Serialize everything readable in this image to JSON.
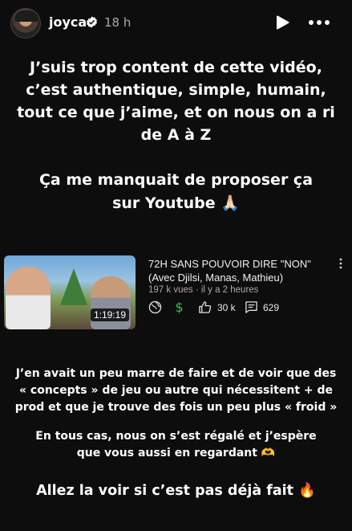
{
  "header": {
    "username": "joyca",
    "time_ago": "18 h",
    "icons": [
      "verified-badge-icon",
      "play-icon",
      "more-options-icon"
    ]
  },
  "story": {
    "paragraph1": "J’suis trop content de cette vidéo, c’est authentique, simple, humain, tout ce que j’aime, et on nous on a ri de A à Z",
    "paragraph2": "Ça me manquait de proposer ça sur Youtube 🙏🏻",
    "paragraph3": "J’en avait un peu marre de faire et de voir que des « concepts » de jeu ou autre qui nécessitent + de prod  et que je trouve des fois un peu plus « froid »",
    "paragraph4": "En tous cas, nous on s’est régalé et j’espère que vous aussi en regardant 🫶",
    "paragraph5": "Allez la voir si c’est pas déjà fait 🔥"
  },
  "video": {
    "title": "72H SANS POUVOIR DIRE \"NON\" (Avec Djilsi, Manas, Mathieu)",
    "meta": "197 k vues · il y a 2 heures",
    "duration": "1:19:19",
    "likes": "30 k",
    "comments": "629",
    "icons": [
      "globe-icon",
      "dollar-icon",
      "thumbs-up-icon",
      "comment-icon",
      "kebab-menu-icon"
    ],
    "colors": {
      "dollar": "#2fbf4a"
    }
  }
}
